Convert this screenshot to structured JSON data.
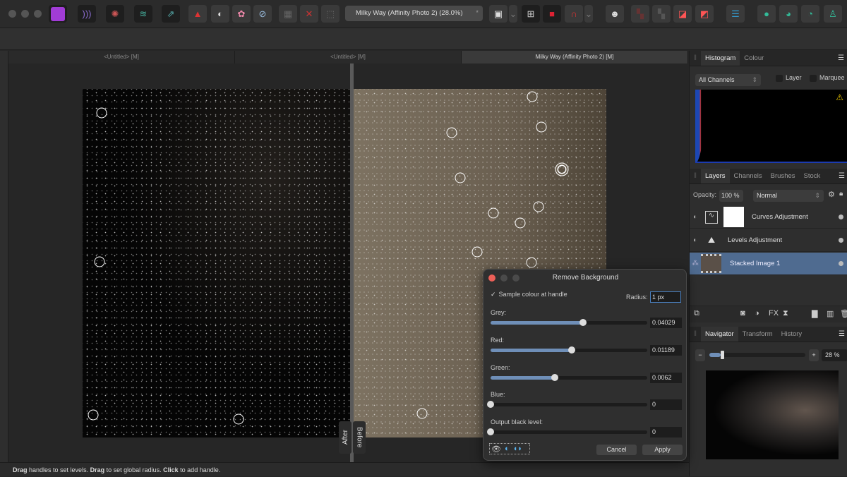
{
  "toolbar": {
    "document_title": "Milky Way (Affinity Photo 2) (28.0%)",
    "modified_mark": "*",
    "icons": [
      "affinity-photo-persona",
      "liquify-persona",
      "develop-persona",
      "tone-mapping-persona",
      "export-persona",
      "levels",
      "black-white",
      "colour-wheel",
      "white-balance",
      "selection-mode",
      "deselect",
      "invert-selection",
      "quick-mask",
      "snapping",
      "assistant",
      "arrange-back",
      "arrange-forward",
      "align",
      "boolean",
      "account"
    ]
  },
  "doc_tabs": [
    "<Untitled> [M]",
    "<Untitled> [M]",
    "Milky Way (Affinity Photo 2) [M]"
  ],
  "canvas": {
    "after_label": "After",
    "before_label": "Before"
  },
  "status": {
    "p1": "Drag",
    "t1": " handles to set levels. ",
    "p2": "Drag",
    "t2": " to set global radius. ",
    "p3": "Click",
    "t3": " to add handle."
  },
  "histogram": {
    "tabs": [
      "Histogram",
      "Colour"
    ],
    "channel": "All Channels",
    "layer_label": "Layer",
    "marquee_label": "Marquee",
    "warning": "⚠"
  },
  "layers": {
    "tabs": [
      "Layers",
      "Channels",
      "Brushes",
      "Stock"
    ],
    "opacity_label": "Opacity:",
    "opacity": "100 %",
    "blend_mode": "Normal",
    "items": [
      {
        "name": "Curves Adjustment"
      },
      {
        "name": "Levels Adjustment"
      },
      {
        "name": "Stacked Image 1",
        "selected": true
      }
    ]
  },
  "navigator": {
    "tabs": [
      "Navigator",
      "Transform",
      "History"
    ],
    "zoom": "28 %",
    "zoom_fraction": 0.12
  },
  "dialog": {
    "title": "Remove Background",
    "sample_label": "Sample colour at handle",
    "sample_checked": true,
    "radius_label": "Radius:",
    "radius": "1 px",
    "sliders": [
      {
        "label": "Grey:",
        "value": "0.04029",
        "fraction": 0.59
      },
      {
        "label": "Red:",
        "value": "0.01189",
        "fraction": 0.52
      },
      {
        "label": "Green:",
        "value": "0.0062",
        "fraction": 0.41
      },
      {
        "label": "Blue:",
        "value": "0",
        "fraction": 0
      },
      {
        "label": "Output black level:",
        "value": "0",
        "fraction": 0
      }
    ],
    "cancel": "Cancel",
    "apply": "Apply"
  },
  "colors": {
    "accent": "#4f6b90",
    "close": "#ec5f57",
    "slider_fill": "#6f8fb8"
  }
}
